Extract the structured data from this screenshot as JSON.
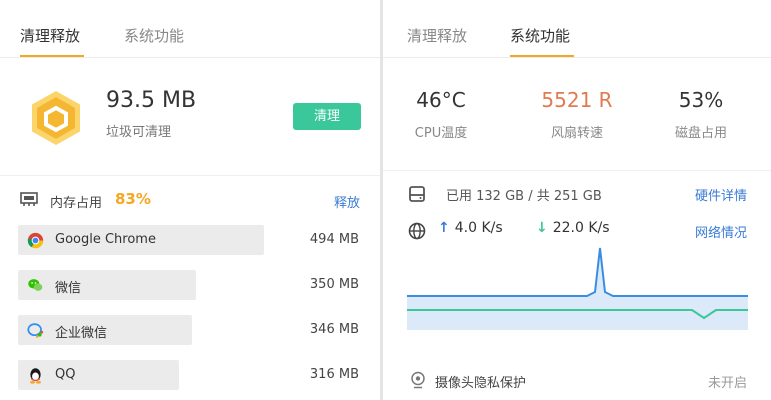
{
  "left_panel": {
    "tabs": [
      {
        "label": "清理释放",
        "active": true
      },
      {
        "label": "系统功能",
        "active": false
      }
    ],
    "clean": {
      "value": "93.5 MB",
      "caption": "垃圾可清理",
      "button_label": "清理"
    },
    "memory": {
      "label": "内存占用",
      "percent": "83%",
      "release_label": "释放"
    },
    "processes": [
      {
        "name": "Google Chrome",
        "memory": "494 MB",
        "icon": "chrome-icon",
        "bar_fraction": 0.72
      },
      {
        "name": "微信",
        "memory": "350 MB",
        "icon": "wechat-icon",
        "bar_fraction": 0.52
      },
      {
        "name": "企业微信",
        "memory": "346 MB",
        "icon": "wework-icon",
        "bar_fraction": 0.51
      },
      {
        "name": "QQ",
        "memory": "316 MB",
        "icon": "qq-icon",
        "bar_fraction": 0.47
      }
    ]
  },
  "right_panel": {
    "tabs": [
      {
        "label": "清理释放",
        "active": false
      },
      {
        "label": "系统功能",
        "active": true
      }
    ],
    "metrics": [
      {
        "value": "46°C",
        "label": "CPU温度",
        "color": "#333333"
      },
      {
        "value": "5521 R",
        "label": "风扇转速",
        "color": "#e07b4f"
      },
      {
        "value": "53%",
        "label": "磁盘占用",
        "color": "#333333"
      }
    ],
    "disk": {
      "text": "已用 132 GB / 共 251 GB",
      "link": "硬件详情"
    },
    "network": {
      "upload": "4.0 K/s",
      "download": "22.0 K/s",
      "link": "网络情况"
    },
    "camera": {
      "label": "摄像头隐私保护",
      "status": "未开启"
    }
  },
  "colors": {
    "accent": "#f5a623",
    "green": "#3ac79a",
    "link": "#3a7bd5",
    "fan": "#e07b4f"
  }
}
